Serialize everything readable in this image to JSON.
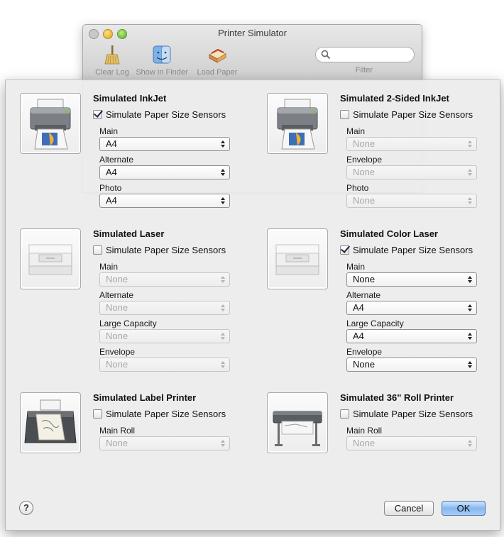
{
  "background_window": {
    "title": "Printer Simulator",
    "toolbar": [
      {
        "label": "Clear Log",
        "icon": "broom-icon"
      },
      {
        "label": "Show in Finder",
        "icon": "finder-icon"
      },
      {
        "label": "Load Paper",
        "icon": "paper-stack-icon"
      }
    ],
    "search_placeholder": "",
    "filter_label": "Filter"
  },
  "printers": [
    {
      "name": "Simulated InkJet",
      "icon": "inkjet-printer-icon",
      "simulate_label": "Simulate Paper Size Sensors",
      "checked": true,
      "fields": [
        {
          "label": "Main",
          "value": "A4"
        },
        {
          "label": "Alternate",
          "value": "A4"
        },
        {
          "label": "Photo",
          "value": "A4"
        }
      ]
    },
    {
      "name": "Simulated 2-Sided InkJet",
      "icon": "inkjet-printer-icon",
      "simulate_label": "Simulate Paper Size Sensors",
      "checked": false,
      "fields": [
        {
          "label": "Main",
          "value": "None"
        },
        {
          "label": "Envelope",
          "value": "None"
        },
        {
          "label": "Photo",
          "value": "None"
        }
      ]
    },
    {
      "name": "Simulated Laser",
      "icon": "laser-printer-icon",
      "simulate_label": "Simulate Paper Size Sensors",
      "checked": false,
      "fields": [
        {
          "label": "Main",
          "value": "None"
        },
        {
          "label": "Alternate",
          "value": "None"
        },
        {
          "label": "Large Capacity",
          "value": "None"
        },
        {
          "label": "Envelope",
          "value": "None"
        }
      ]
    },
    {
      "name": "Simulated Color Laser",
      "icon": "laser-printer-icon",
      "simulate_label": "Simulate Paper Size Sensors",
      "checked": true,
      "fields": [
        {
          "label": "Main",
          "value": "None"
        },
        {
          "label": "Alternate",
          "value": "A4"
        },
        {
          "label": "Large Capacity",
          "value": "A4"
        },
        {
          "label": "Envelope",
          "value": "None"
        }
      ]
    },
    {
      "name": "Simulated Label Printer",
      "icon": "label-printer-icon",
      "simulate_label": "Simulate Paper Size Sensors",
      "checked": false,
      "fields": [
        {
          "label": "Main Roll",
          "value": "None"
        }
      ]
    },
    {
      "name": "Simulated 36\" Roll Printer",
      "icon": "roll-printer-icon",
      "simulate_label": "Simulate Paper Size Sensors",
      "checked": false,
      "fields": [
        {
          "label": "Main Roll",
          "value": "None"
        }
      ]
    }
  ],
  "buttons": {
    "help": "?",
    "cancel": "Cancel",
    "ok": "OK"
  },
  "colors": {
    "default_button": "#86b7ef",
    "sheet_background": "#ececec"
  }
}
